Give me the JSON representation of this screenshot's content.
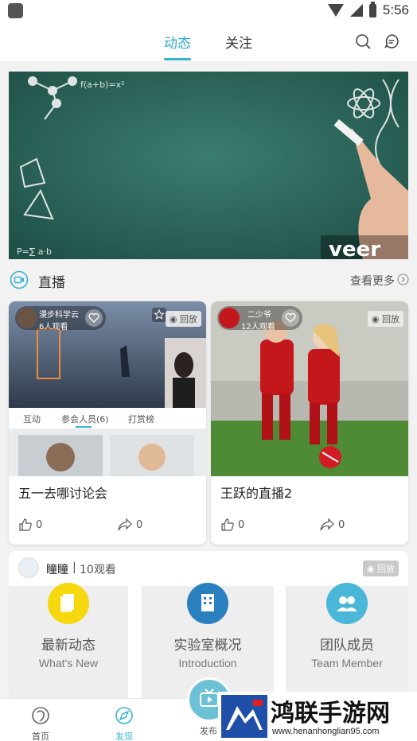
{
  "status_bar": {
    "time": "5:56"
  },
  "header": {
    "tabs": [
      {
        "label": "动态",
        "active": true
      },
      {
        "label": "关注",
        "active": false
      }
    ],
    "accent_color": "#3ab3d1"
  },
  "banner": {
    "watermark_text": "veer"
  },
  "live_section": {
    "title": "直播",
    "more_label": "查看更多"
  },
  "cards": [
    {
      "user": "漫步科学云",
      "viewers": "6人观看",
      "badge": "回放",
      "inner_tabs": [
        "互动",
        "参会人员(6)",
        "打赏榜"
      ],
      "title": "五一去哪讨论会",
      "likes": "0",
      "shares": "0"
    },
    {
      "user": "二少爷",
      "viewers": "12人观看",
      "badge": "回放",
      "title": "王跃的直播2",
      "likes": "0",
      "shares": "0"
    }
  ],
  "group_card": {
    "name": "瞳瞳",
    "viewers": "10观看",
    "badge": "回放",
    "tiles": [
      {
        "title": "最新动态",
        "subtitle": "What's New",
        "color": "#f5d80e",
        "icon": "document-icon"
      },
      {
        "title": "实验室概况",
        "subtitle": "Introduction",
        "color": "#2a7fbf",
        "icon": "building-icon"
      },
      {
        "title": "团队成员",
        "subtitle": "Team Member",
        "color": "#4ab6d8",
        "icon": "team-icon"
      }
    ]
  },
  "bottom_nav": {
    "items": [
      {
        "label": "首页",
        "active": false
      },
      {
        "label": "发现",
        "active": true
      },
      {
        "label": "发布",
        "active": false
      }
    ]
  },
  "watermark": {
    "title": "鸿联手游网",
    "url": "www.henanhonglian95.com"
  }
}
